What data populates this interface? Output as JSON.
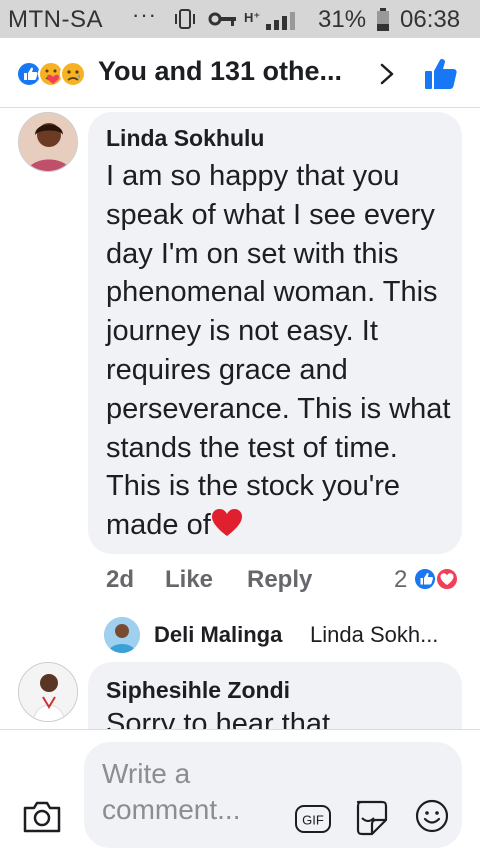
{
  "status_bar": {
    "carrier": "MTN-SA",
    "dots": "···",
    "network": "H⁺",
    "battery_pct": "31%",
    "time": "06:38"
  },
  "header": {
    "title": "You and 131 othe...",
    "reaction_icons": [
      "like-icon",
      "care-icon",
      "sad-icon"
    ],
    "chevron_icon": "chevron-right-icon",
    "like_button_icon": "thumbs-up-icon"
  },
  "comments": [
    {
      "author": "Linda Sokhulu",
      "text": "I am so happy that you speak of what I see every day I'm on set with this phenomenal woman. This journey is not easy. It requires grace and perseverance. This is what stands the test of time. This is the stock you're made of",
      "time": "2d",
      "like_label": "Like",
      "reply_label": "Reply",
      "reaction_count": "2",
      "reactions": [
        "like-icon",
        "love-icon"
      ]
    },
    {
      "author": "Siphesihle Zondi",
      "text": "Sorry to hear that"
    }
  ],
  "reply_preview": {
    "author": "Deli Malinga",
    "text": "Linda Sokh..."
  },
  "composer": {
    "placeholder": "Write a comment...",
    "gif_label": "GIF"
  },
  "colors": {
    "facebook_blue": "#1877f2",
    "love_red": "#f33e58",
    "bubble_bg": "#f0f2f5",
    "secondary_text": "#65676b"
  }
}
